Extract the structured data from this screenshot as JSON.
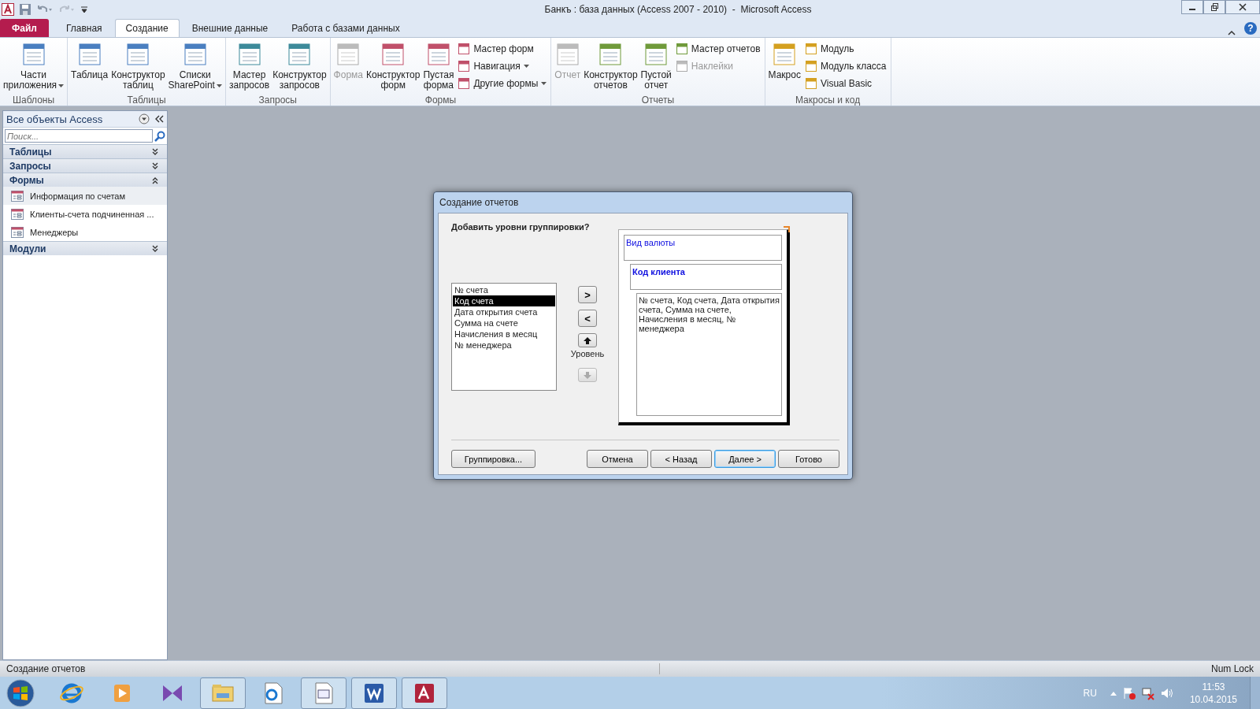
{
  "window": {
    "title": "Банкъ : база данных (Access 2007 - 2010)  -  Microsoft Access",
    "help": "?"
  },
  "tabs": [
    {
      "label": "Файл",
      "kind": "file",
      "selected": false
    },
    {
      "label": "Главная",
      "kind": "tab",
      "selected": false
    },
    {
      "label": "Создание",
      "kind": "tab",
      "selected": true
    },
    {
      "label": "Внешние данные",
      "kind": "tab",
      "selected": false
    },
    {
      "label": "Работа с базами данных",
      "kind": "tab",
      "selected": false
    }
  ],
  "ribbon": {
    "groups": [
      {
        "label": "Шаблоны",
        "items": [
          {
            "label": "Части\nприложения",
            "menu": true,
            "disabled": false
          }
        ]
      },
      {
        "label": "Таблицы",
        "items": [
          {
            "label": "Таблица",
            "menu": false,
            "disabled": false
          },
          {
            "label": "Конструктор\nтаблиц",
            "menu": false,
            "disabled": false
          },
          {
            "label": "Списки\nSharePoint",
            "menu": true,
            "disabled": false
          }
        ]
      },
      {
        "label": "Запросы",
        "items": [
          {
            "label": "Мастер\nзапросов",
            "menu": false,
            "disabled": false
          },
          {
            "label": "Конструктор\nзапросов",
            "menu": false,
            "disabled": false
          }
        ]
      },
      {
        "label": "Формы",
        "items": [
          {
            "label": "Форма",
            "menu": false,
            "disabled": true
          },
          {
            "label": "Конструктор\nформ",
            "menu": false,
            "disabled": false
          },
          {
            "label": "Пустая\nформа",
            "menu": false,
            "disabled": false
          }
        ],
        "small_items": [
          {
            "label": "Мастер форм",
            "menu": false,
            "disabled": false
          },
          {
            "label": "Навигация",
            "menu": true,
            "disabled": false
          },
          {
            "label": "Другие формы",
            "menu": true,
            "disabled": false
          }
        ]
      },
      {
        "label": "Отчеты",
        "items": [
          {
            "label": "Отчет",
            "menu": false,
            "disabled": true
          },
          {
            "label": "Конструктор\nотчетов",
            "menu": false,
            "disabled": false
          },
          {
            "label": "Пустой\nотчет",
            "menu": false,
            "disabled": false
          }
        ],
        "small_items": [
          {
            "label": "Мастер отчетов",
            "menu": false,
            "disabled": false
          },
          {
            "label": "Наклейки",
            "menu": false,
            "disabled": true
          }
        ]
      },
      {
        "label": "Макросы и код",
        "items": [
          {
            "label": "Макрос",
            "menu": false,
            "disabled": false
          }
        ],
        "small_items": [
          {
            "label": "Модуль",
            "menu": false,
            "disabled": false
          },
          {
            "label": "Модуль класса",
            "menu": false,
            "disabled": false
          },
          {
            "label": "Visual Basic",
            "menu": false,
            "disabled": false
          }
        ]
      }
    ]
  },
  "navigation": {
    "title": "Все объекты Access",
    "search": {
      "placeholder": "Поиск..."
    },
    "groups": [
      {
        "label": "Таблицы",
        "expanded": false
      },
      {
        "label": "Запросы",
        "expanded": false
      },
      {
        "label": "Формы",
        "expanded": true,
        "items": [
          {
            "label": "Информация по счетам",
            "selected": true
          },
          {
            "label": "Клиенты-счета подчиненная ...",
            "selected": false
          },
          {
            "label": "Менеджеры",
            "selected": false
          }
        ]
      },
      {
        "label": "Модули",
        "expanded": false
      }
    ]
  },
  "dialog": {
    "title": "Создание отчетов",
    "question": "Добавить уровни группировки?",
    "fields": [
      {
        "label": "№ счета",
        "selected": false
      },
      {
        "label": "Код счета",
        "selected": true
      },
      {
        "label": "Дата открытия счета",
        "selected": false
      },
      {
        "label": "Сумма на счете",
        "selected": false
      },
      {
        "label": "Начисления в месяц",
        "selected": false
      },
      {
        "label": "№ менеджера",
        "selected": false
      }
    ],
    "move_buttons": [
      {
        "label": ">",
        "disabled": false
      },
      {
        "label": "<",
        "disabled": false
      }
    ],
    "priority": {
      "label": "Уровень",
      "up": {
        "disabled": false
      },
      "down": {
        "disabled": true
      }
    },
    "preview": {
      "groups": [
        {
          "label": "Вид валюты",
          "bold": false
        },
        {
          "label": "Код клиента",
          "bold": true
        }
      ],
      "detail": "№ счета, Код счета, Дата открытия счета, Сумма на счете, Начисления в месяц, № менеджера"
    },
    "left_button": {
      "label": "Группировка...",
      "default": false
    },
    "buttons": [
      {
        "label": "Отмена",
        "default": false
      },
      {
        "label": "< Назад",
        "default": false
      },
      {
        "label": "Далее >",
        "default": true
      },
      {
        "label": "Готово",
        "default": false
      }
    ]
  },
  "status_bar": {
    "text": "Создание отчетов",
    "indicator": "Num Lock"
  },
  "taskbar": {
    "apps": [
      {
        "running": false
      },
      {
        "running": false
      },
      {
        "running": false
      },
      {
        "running": true
      },
      {
        "running": false
      },
      {
        "running": true
      },
      {
        "running": true
      },
      {
        "running": true
      }
    ],
    "language": "RU",
    "time": "11:53",
    "date": "10.04.2015"
  }
}
